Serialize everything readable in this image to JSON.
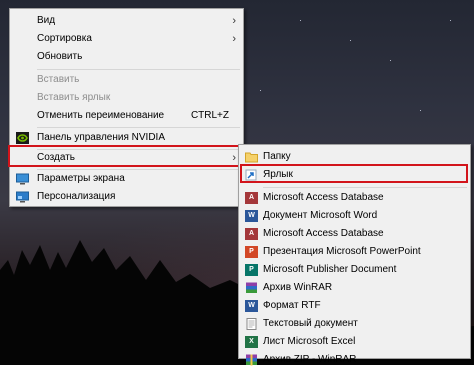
{
  "main_menu": {
    "items": [
      {
        "label": "Вид",
        "submenu": true
      },
      {
        "label": "Сортировка",
        "submenu": true
      },
      {
        "label": "Обновить"
      },
      {
        "label": "Вставить",
        "disabled": true
      },
      {
        "label": "Вставить ярлык",
        "disabled": true
      },
      {
        "label": "Отменить переименование",
        "shortcut": "CTRL+Z"
      },
      {
        "label": "Панель управления NVIDIA",
        "icon": "nvidia-icon"
      },
      {
        "label": "Создать",
        "submenu": true,
        "highlighted": true
      },
      {
        "label": "Параметры экрана",
        "icon": "display-icon"
      },
      {
        "label": "Персонализация",
        "icon": "personalization-icon"
      }
    ]
  },
  "create_submenu": {
    "items": [
      {
        "label": "Папку",
        "icon": "folder-icon"
      },
      {
        "label": "Ярлык",
        "icon": "shortcut-icon",
        "highlighted": true
      },
      {
        "label": "Microsoft Access Database",
        "icon": "access-icon"
      },
      {
        "label": "Документ Microsoft Word",
        "icon": "word-icon"
      },
      {
        "label": "Microsoft Access Database",
        "icon": "access-icon"
      },
      {
        "label": "Презентация Microsoft PowerPoint",
        "icon": "powerpoint-icon"
      },
      {
        "label": "Microsoft Publisher Document",
        "icon": "publisher-icon"
      },
      {
        "label": "Архив WinRAR",
        "icon": "winrar-icon"
      },
      {
        "label": "Формат RTF",
        "icon": "rtf-icon"
      },
      {
        "label": "Текстовый документ",
        "icon": "text-document-icon"
      },
      {
        "label": "Лист Microsoft Excel",
        "icon": "excel-icon"
      },
      {
        "label": "Архив ZIP - WinRAR",
        "icon": "winrar-zip-icon"
      }
    ]
  },
  "arrow_glyph": "›",
  "colors": {
    "highlight_border": "#d2141b",
    "menu_background": "#f0f0f0",
    "disabled_text": "#8d8d8d"
  }
}
